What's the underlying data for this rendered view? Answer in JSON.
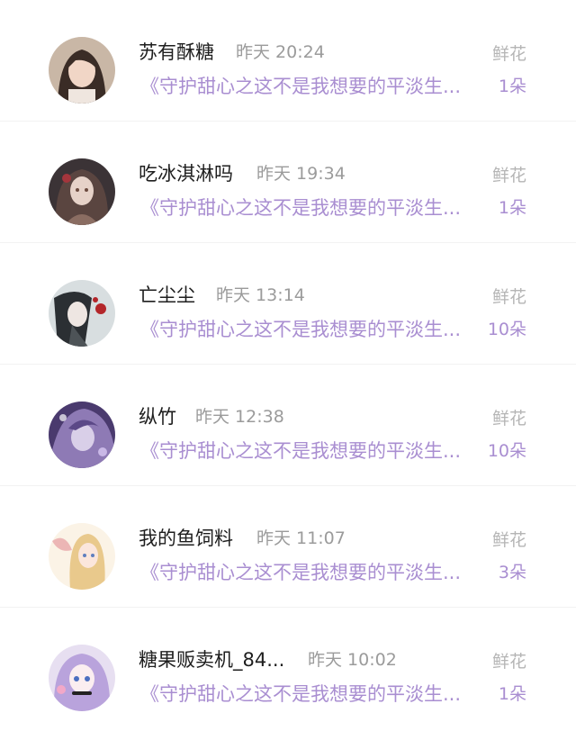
{
  "items": [
    {
      "name": "苏有酥糖",
      "time": "昨天 20:24",
      "desc": "《守护甜心之这不是我想要的平淡生...",
      "gift_label": "鲜花",
      "gift_count": "1朵",
      "avatar_colors": [
        "#c9b7a6",
        "#3a2c26",
        "#f1d6c6"
      ]
    },
    {
      "name": "吃冰淇淋吗",
      "time": "昨天 19:34",
      "desc": "《守护甜心之这不是我想要的平淡生...",
      "gift_label": "鲜花",
      "gift_count": "1朵",
      "avatar_colors": [
        "#3b3336",
        "#8a6d62",
        "#e6d2c8"
      ]
    },
    {
      "name": "亡尘尘",
      "time": "昨天 13:14",
      "desc": "《守护甜心之这不是我想要的平淡生...",
      "gift_label": "鲜花",
      "gift_count": "10朵",
      "avatar_colors": [
        "#d8dee0",
        "#2b2f33",
        "#b3262a"
      ]
    },
    {
      "name": "纵竹",
      "time": "昨天 12:38",
      "desc": "《守护甜心之这不是我想要的平淡生...",
      "gift_label": "鲜花",
      "gift_count": "10朵",
      "avatar_colors": [
        "#4a3a6e",
        "#8e7ab5",
        "#d9cfe8"
      ]
    },
    {
      "name": "我的鱼饲料",
      "time": "昨天 11:07",
      "desc": "《守护甜心之这不是我想要的平淡生...",
      "gift_label": "鲜花",
      "gift_count": "3朵",
      "avatar_colors": [
        "#fbf3e6",
        "#e9c98c",
        "#e8a6a9"
      ]
    },
    {
      "name": "糖果贩卖机_84...",
      "time": "昨天 10:02",
      "desc": "《守护甜心之这不是我想要的平淡生...",
      "gift_label": "鲜花",
      "gift_count": "1朵",
      "avatar_colors": [
        "#e7dff1",
        "#b9a3dc",
        "#222222"
      ]
    }
  ],
  "accent_color": "#a98ed1"
}
